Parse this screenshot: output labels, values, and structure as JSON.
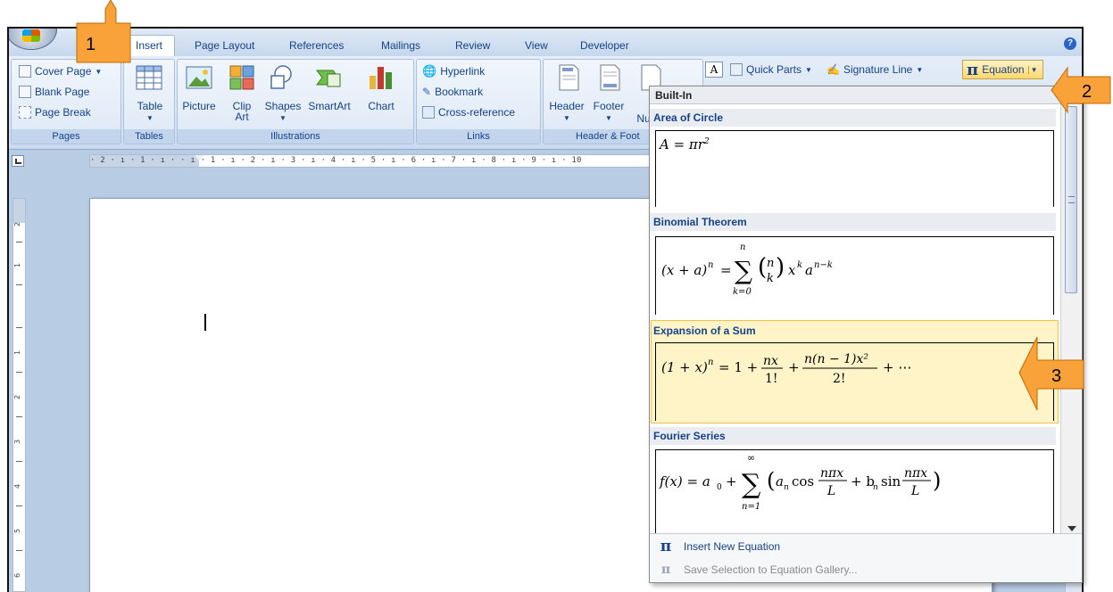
{
  "tabs": [
    {
      "label": "Insert",
      "active": true
    },
    {
      "label": "Page Layout"
    },
    {
      "label": "References"
    },
    {
      "label": "Mailings"
    },
    {
      "label": "Review"
    },
    {
      "label": "View"
    },
    {
      "label": "Developer"
    }
  ],
  "ribbon": {
    "pages": {
      "cover_page": "Cover Page",
      "blank_page": "Blank Page",
      "page_break": "Page Break",
      "group": "Pages"
    },
    "tables": {
      "table": "Table",
      "group": "Tables"
    },
    "illustrations": {
      "picture": "Picture",
      "clip_art_1": "Clip",
      "clip_art_2": "Art",
      "shapes": "Shapes",
      "smartart": "SmartArt",
      "chart": "Chart",
      "group": "Illustrations"
    },
    "links": {
      "hyperlink": "Hyperlink",
      "bookmark": "Bookmark",
      "cross_reference": "Cross-reference",
      "group": "Links"
    },
    "header_footer": {
      "header": "Header",
      "footer": "Footer",
      "nu": "Nu",
      "group": "Header & Foot"
    },
    "text": {
      "quick_parts": "Quick Parts",
      "signature_line": "Signature Line"
    },
    "symbols": {
      "equation": "Equation"
    }
  },
  "ruler": {
    "text": "· 2 · ı · 1 · ı ·    · ı · 1 · ı · 2 · ı · 3 · ı · 4 · ı · 5 · ı · 6 · ı · 7 · ı · 8 · ı · 9 · ı · 10"
  },
  "vruler": {
    "numbers": [
      "2",
      "1",
      "1",
      "2",
      "3",
      "4",
      "5",
      "6"
    ]
  },
  "gallery": {
    "header": "Built-In",
    "equations": [
      {
        "title": "Area of Circle",
        "formula": "A = πr²"
      },
      {
        "title": "Binomial Theorem",
        "formula": "(x + a)ⁿ = Σ (n k) xᵏaⁿ⁻ᵏ"
      },
      {
        "title": "Expansion of a Sum",
        "formula": "(1 + x)ⁿ = 1 + nx/1! + n(n − 1)x²/2! + ⋯"
      },
      {
        "title": "Fourier Series",
        "formula": "f(x) = a₀ + Σ (aₙ cos nπx/L + bₙ sin nπx/L)"
      }
    ],
    "footer": {
      "insert_new": "Insert New Equation",
      "save_selection": "Save Selection to Equation Gallery..."
    }
  },
  "callouts": [
    "1",
    "2",
    "3"
  ],
  "colors": {
    "ribbon_text": "#15428b",
    "callout_fill": "#f9a23a",
    "highlight": "#fff4c8"
  }
}
